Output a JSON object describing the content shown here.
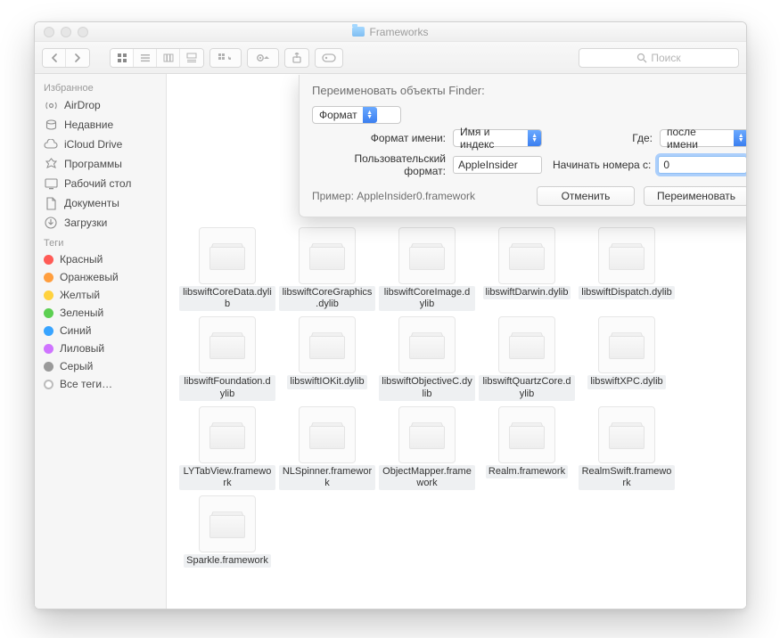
{
  "window": {
    "title": "Frameworks"
  },
  "toolbar": {
    "search_placeholder": "Поиск"
  },
  "sidebar": {
    "favorites_header": "Избранное",
    "items": [
      {
        "label": "AirDrop"
      },
      {
        "label": "Недавние"
      },
      {
        "label": "iCloud Drive"
      },
      {
        "label": "Программы"
      },
      {
        "label": "Рабочий стол"
      },
      {
        "label": "Документы"
      },
      {
        "label": "Загрузки"
      }
    ],
    "tags_header": "Теги",
    "tags": [
      {
        "label": "Красный",
        "color": "#ff5b56"
      },
      {
        "label": "Оранжевый",
        "color": "#ff9e3e"
      },
      {
        "label": "Желтый",
        "color": "#ffd23e"
      },
      {
        "label": "Зеленый",
        "color": "#5ccf51"
      },
      {
        "label": "Синий",
        "color": "#38a4ff"
      },
      {
        "label": "Лиловый",
        "color": "#cf74ff"
      },
      {
        "label": "Серый",
        "color": "#9a9a9a"
      },
      {
        "label": "Все теги…"
      }
    ]
  },
  "dialog": {
    "title": "Переименовать объекты Finder:",
    "mode_label": "Формат",
    "name_format_label": "Формат имени:",
    "name_format_value": "Имя и индекс",
    "where_label": "Где:",
    "where_value": "после имени",
    "custom_format_label": "Пользовательский формат:",
    "custom_format_value": "AppleInsider",
    "start_number_label": "Начинать номера с:",
    "start_number_value": "0",
    "example_label": "Пример: AppleInsider0.framework",
    "cancel_label": "Отменить",
    "rename_label": "Переименовать"
  },
  "files": [
    {
      "name": "libswiftCoreData.dylib"
    },
    {
      "name": "libswiftCoreGraphics.dylib"
    },
    {
      "name": "libswiftCoreImage.dylib"
    },
    {
      "name": "libswiftDarwin.dylib"
    },
    {
      "name": "libswiftDispatch.dylib"
    },
    {
      "name": "libswiftFoundation.dylib"
    },
    {
      "name": "libswiftIOKit.dylib"
    },
    {
      "name": "libswiftObjectiveC.dylib"
    },
    {
      "name": "libswiftQuartzCore.dylib"
    },
    {
      "name": "libswiftXPC.dylib"
    },
    {
      "name": "LYTabView.framework"
    },
    {
      "name": "NLSpinner.framework"
    },
    {
      "name": "ObjectMapper.framework"
    },
    {
      "name": "Realm.framework"
    },
    {
      "name": "RealmSwift.framework"
    },
    {
      "name": "Sparkle.framework"
    }
  ],
  "partial_file_label": ".dylib"
}
